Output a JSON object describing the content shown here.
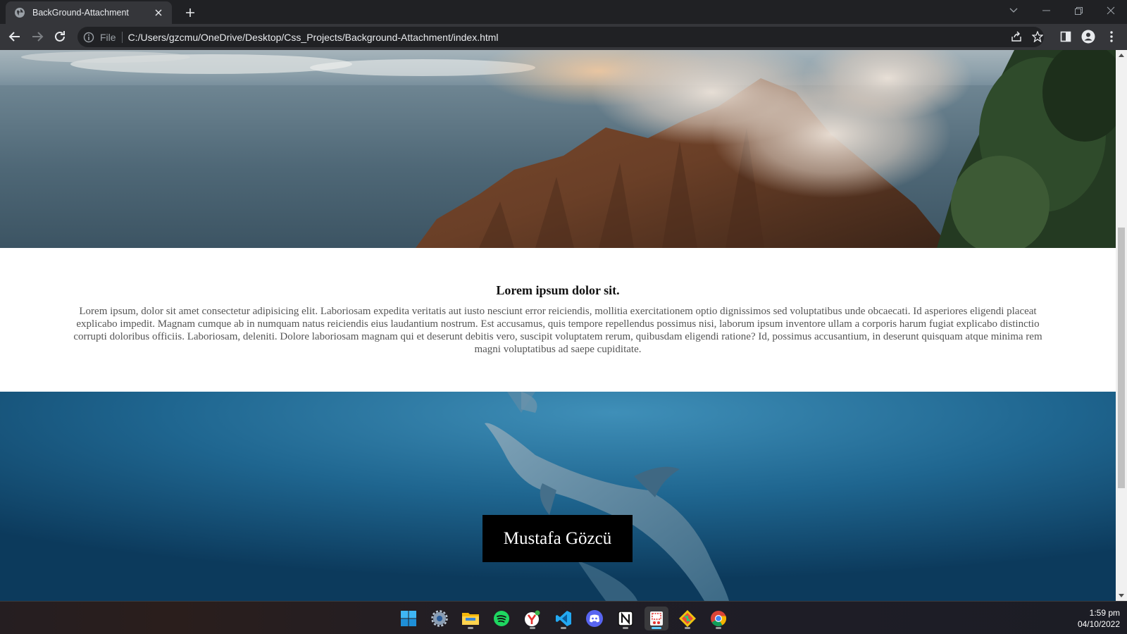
{
  "browser": {
    "tab": {
      "title": "BackGround-Attachment",
      "favicon": "globe-icon"
    },
    "omnibox": {
      "scheme_label": "File",
      "url": "C:/Users/gzcmu/OneDrive/Desktop/Css_Projects/Background-Attachment/index.html"
    },
    "icons": {
      "back": "arrow-left-icon",
      "forward": "arrow-right-icon",
      "reload": "reload-icon",
      "share": "share-icon",
      "bookmark": "star-icon",
      "sidepanel": "side-panel-icon",
      "profile": "profile-icon",
      "menu": "kebab-menu-icon"
    }
  },
  "page": {
    "heading": "Lorem ipsum dolor sit.",
    "paragraph": "Lorem ipsum, dolor sit amet consectetur adipisicing elit. Laboriosam expedita veritatis aut iusto nesciunt error reiciendis, mollitia exercitationem optio dignissimos sed voluptatibus unde obcaecati. Id asperiores eligendi placeat explicabo impedit. Magnam cumque ab in numquam natus reiciendis eius laudantium nostrum. Est accusamus, quis tempore repellendus possimus nisi, laborum ipsum inventore ullam a corporis harum fugiat explicabo distinctio corrupti doloribus officiis. Laboriosam, deleniti. Dolore laboriosam magnam qui et deserunt debitis vero, suscipit voluptatem rerum, quibusdam eligendi ratione? Id, possimus accusantium, in deserunt quisquam atque minima rem magni voluptatibus ad saepe cupiditate.",
    "name_box": "Mustafa Gözcü",
    "images": [
      "mountain-sea-photo",
      "dolphins-underwater-photo"
    ]
  },
  "taskbar": {
    "apps": [
      "windows-start-icon",
      "settings-icon",
      "file-explorer-icon",
      "spotify-icon",
      "yandex-browser-icon",
      "vscode-icon",
      "discord-icon",
      "notion-icon",
      "snipping-tool-icon",
      "git-icon",
      "chrome-icon"
    ],
    "time": "1:59 pm",
    "date": "04/10/2022"
  },
  "colors": {
    "chrome_dark": "#202124",
    "chrome_toolbar": "#35363a",
    "taskbar_accent": "#60cdff"
  }
}
